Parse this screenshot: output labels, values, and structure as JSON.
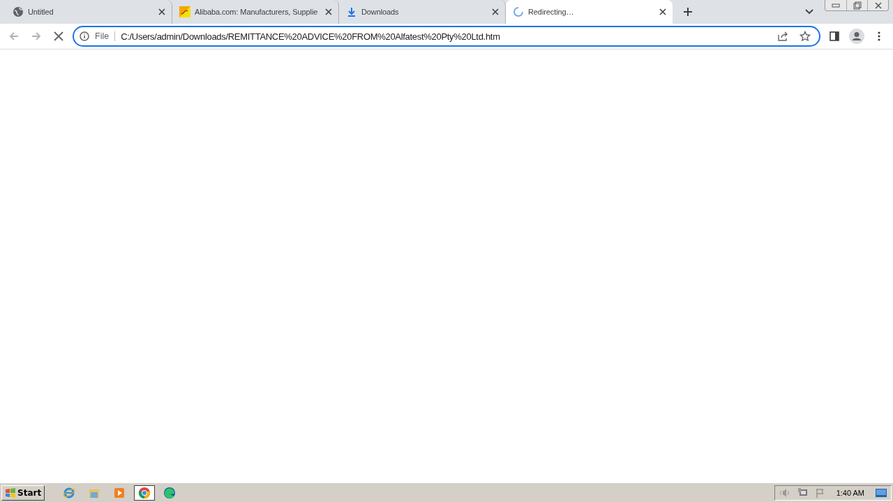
{
  "tabs": [
    {
      "title": "Untitled",
      "kind": "globe",
      "selected": false
    },
    {
      "title": "Alibaba.com: Manufacturers, Supplie",
      "kind": "site",
      "selected": false
    },
    {
      "title": "Downloads",
      "kind": "download",
      "selected": false
    },
    {
      "title": "Redirecting…",
      "kind": "loading",
      "selected": true
    }
  ],
  "address_bar": {
    "scheme": "File",
    "url": "C:/Users/admin/Downloads/REMITTANCE%20ADVICE%20FROM%20Alfatest%20Pty%20Ltd.htm"
  },
  "taskbar": {
    "start": "Start",
    "apps": [
      {
        "kind": "ie",
        "selected": false
      },
      {
        "kind": "folder",
        "selected": false
      },
      {
        "kind": "media",
        "selected": false
      },
      {
        "kind": "chrome",
        "selected": true
      },
      {
        "kind": "edge",
        "selected": false
      }
    ],
    "clock": "1:40 AM"
  }
}
